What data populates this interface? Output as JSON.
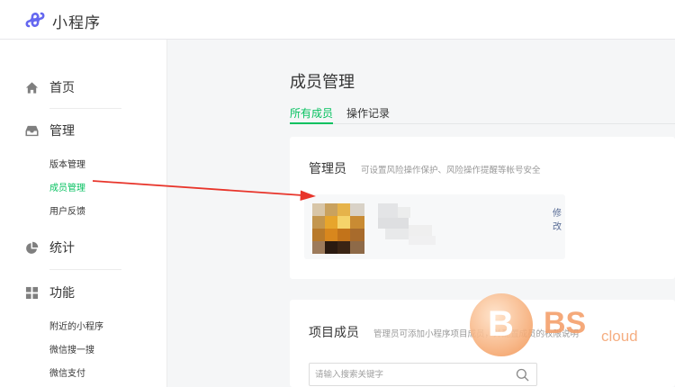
{
  "header": {
    "app_title": "小程序"
  },
  "sidebar": {
    "groups": [
      {
        "label": "首页",
        "icon": "home-icon"
      },
      {
        "label": "管理",
        "icon": "inbox-icon",
        "items": [
          {
            "label": "版本管理"
          },
          {
            "label": "成员管理",
            "active": true
          },
          {
            "label": "用户反馈"
          }
        ]
      },
      {
        "label": "统计",
        "icon": "pie-chart-icon"
      },
      {
        "label": "功能",
        "icon": "grid-icon",
        "items": [
          {
            "label": "附近的小程序"
          },
          {
            "label": "微信搜一搜"
          },
          {
            "label": "微信支付"
          }
        ]
      }
    ]
  },
  "main": {
    "page_title": "成员管理",
    "tabs": [
      {
        "label": "所有成员",
        "active": true
      },
      {
        "label": "操作记录",
        "active": false
      }
    ],
    "admin_card": {
      "title": "管理员",
      "desc": "可设置风险操作保护、风险操作提醒等帐号安全",
      "edit_label": "修改"
    },
    "project_card": {
      "title": "项目成员",
      "desc": "管理员可添加小程序项目成员，并配置成员的权限说明",
      "search_placeholder": "请输入搜索关键字"
    }
  },
  "watermark": {
    "letter": "B",
    "brand": "BS",
    "suffix": "cloud"
  },
  "colors": {
    "accent": "#07c160",
    "link": "#576b95",
    "arrow": "#e8352b"
  }
}
